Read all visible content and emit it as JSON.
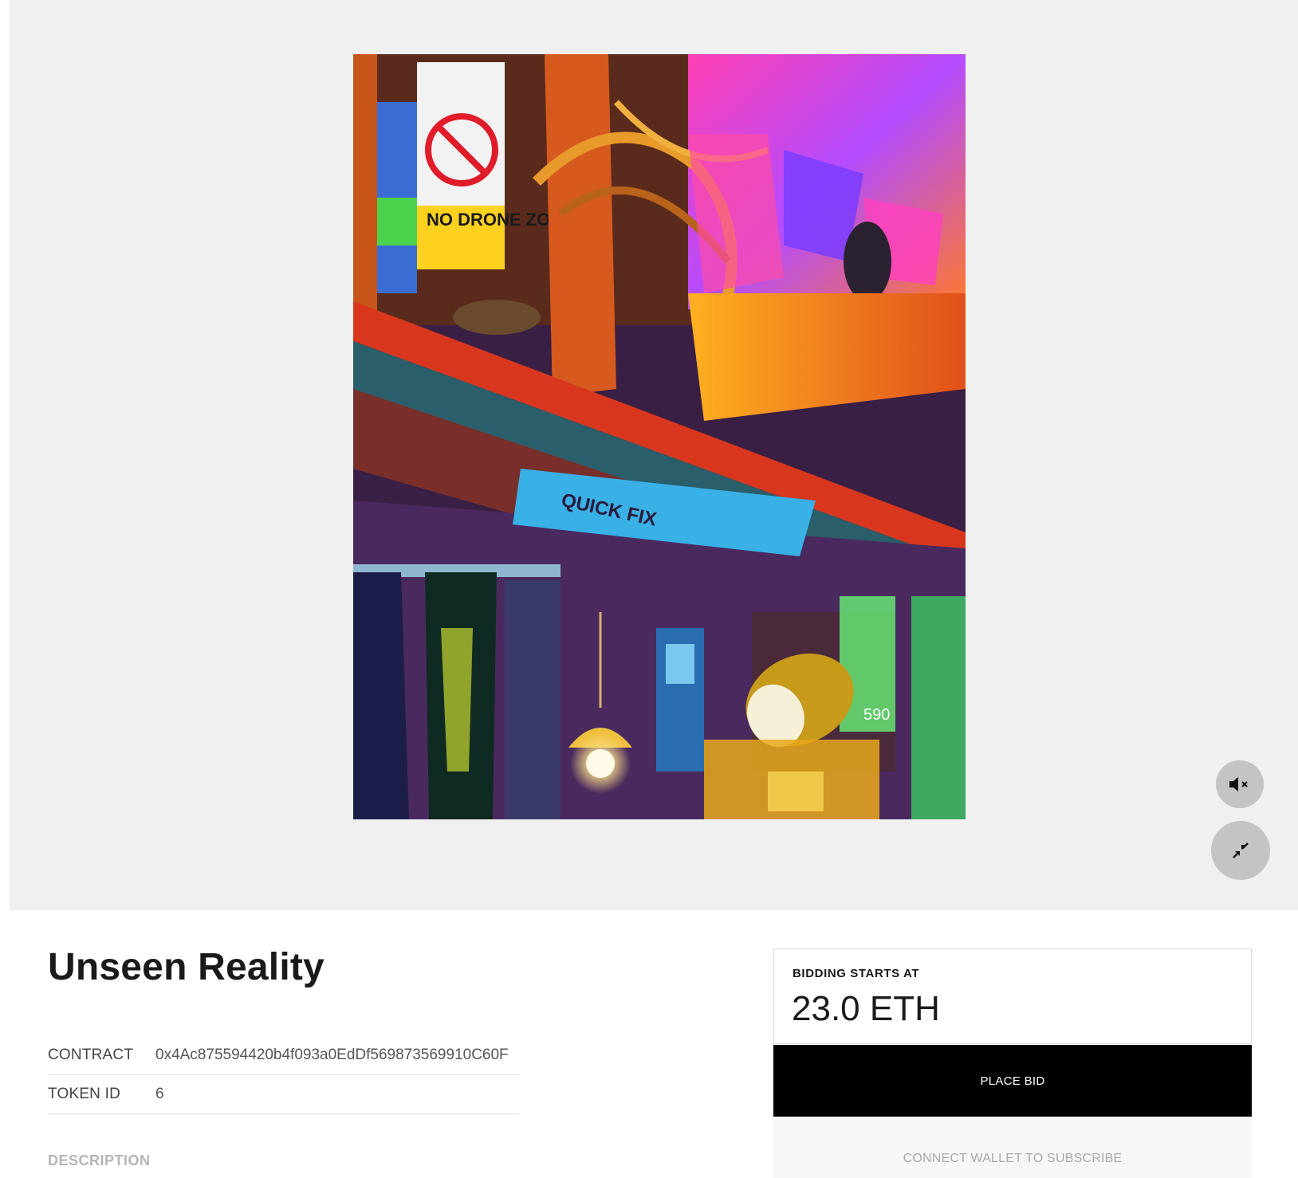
{
  "artwork": {
    "title": "Unseen Reality",
    "sign_text": "NO DRONE ZONE",
    "shop_sign_text": "QUICK FIX",
    "number_text": "590"
  },
  "media_controls": {
    "mute_icon": "speaker-muted-icon",
    "fullscreen_icon": "collapse-arrows-icon"
  },
  "details": {
    "contract_label": "CONTRACT",
    "contract_value": "0x4Ac875594420b4f093a0EdDf569873569910C60F",
    "token_id_label": "TOKEN ID",
    "token_id_value": "6",
    "description_heading": "DESCRIPTION"
  },
  "bid": {
    "label": "BIDDING STARTS AT",
    "price": "23.0 ETH",
    "place_bid_label": "PLACE BID",
    "subscribe_label": "CONNECT WALLET TO SUBSCRIBE"
  },
  "colors": {
    "stage_bg": "#f0f0f0",
    "button_dark": "#000000",
    "control_grey": "#c4c4c4"
  }
}
